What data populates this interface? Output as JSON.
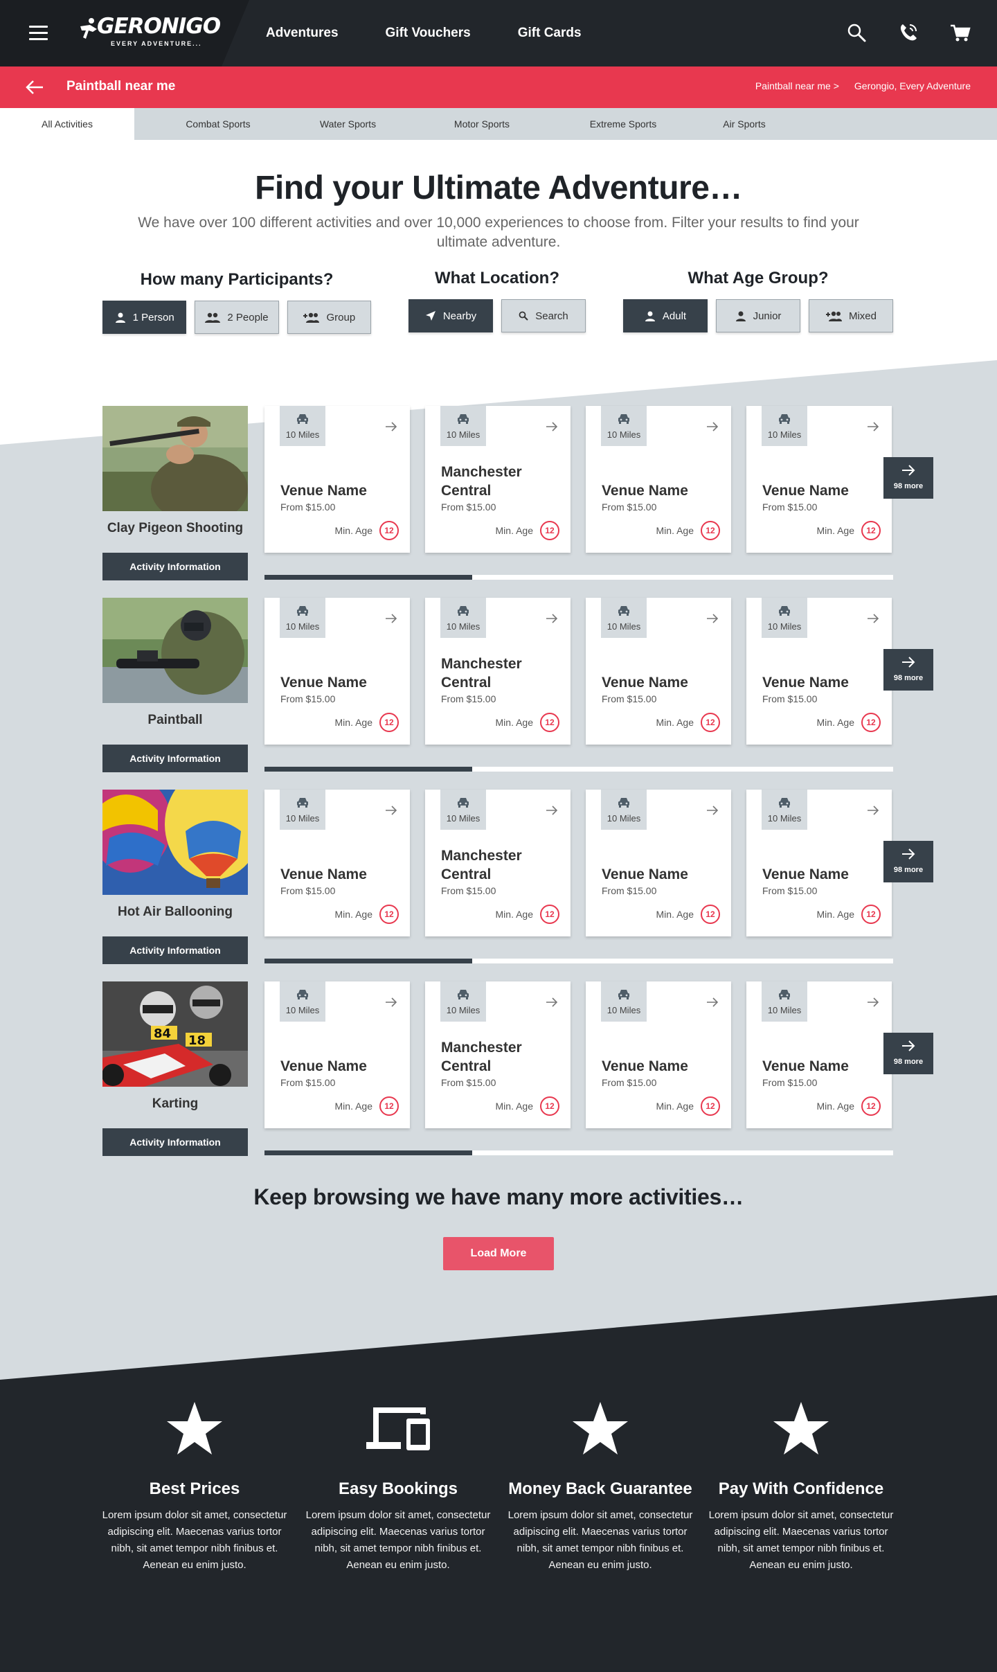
{
  "header": {
    "logo_text": "GERONIGO",
    "logo_tagline": "EVERY ADVENTURE...",
    "nav": [
      "Adventures",
      "Gift Vouchers",
      "Gift Cards"
    ],
    "icons": [
      "menu-icon",
      "search-icon",
      "phone-icon",
      "cart-icon"
    ]
  },
  "page_bar": {
    "title": "Paintball near me",
    "breadcrumbs": [
      "Paintball near me >",
      "Gerongio, Every Adventure"
    ]
  },
  "tabs": [
    {
      "label": "All Activities",
      "active": true
    },
    {
      "label": "Combat Sports",
      "active": false
    },
    {
      "label": "Water Sports",
      "active": false
    },
    {
      "label": "Motor Sports",
      "active": false
    },
    {
      "label": "Extreme Sports",
      "active": false
    },
    {
      "label": "Air Sports",
      "active": false
    }
  ],
  "hero": {
    "title": "Find your Ultimate Adventure…",
    "subtitle": "We have over 100 different activities and over 10,000 experiences to choose from. Filter your results to find your ultimate adventure."
  },
  "filters": {
    "participants": {
      "title": "How many Participants?",
      "options": [
        "1 Person",
        "2 People",
        "Group"
      ],
      "selected": "1 Person"
    },
    "location": {
      "title": "What Location?",
      "options": [
        "Nearby",
        "Search"
      ],
      "selected": "Nearby"
    },
    "age": {
      "title": "What Age Group?",
      "options": [
        "Adult",
        "Junior",
        "Mixed"
      ],
      "selected": "Adult"
    }
  },
  "activities": [
    {
      "name": "Clay Pigeon Shooting",
      "info_label": "Activity Information",
      "more_label": "98 more",
      "progress": 0.33,
      "venues": [
        {
          "distance": "10 Miles",
          "name": "Venue Name",
          "price": "From $15.00",
          "min_age_label": "Min. Age",
          "min_age": "12"
        },
        {
          "distance": "10 Miles",
          "name": "Manchester Central",
          "price": "From $15.00",
          "min_age_label": "Min. Age",
          "min_age": "12"
        },
        {
          "distance": "10 Miles",
          "name": "Venue Name",
          "price": "From $15.00",
          "min_age_label": "Min. Age",
          "min_age": "12"
        },
        {
          "distance": "10 Miles",
          "name": "Venue Name",
          "price": "From $15.00",
          "min_age_label": "Min. Age",
          "min_age": "12"
        }
      ]
    },
    {
      "name": "Paintball",
      "info_label": "Activity Information",
      "more_label": "98 more",
      "progress": 0.33,
      "venues": [
        {
          "distance": "10 Miles",
          "name": "Venue Name",
          "price": "From $15.00",
          "min_age_label": "Min. Age",
          "min_age": "12"
        },
        {
          "distance": "10 Miles",
          "name": "Manchester Central",
          "price": "From $15.00",
          "min_age_label": "Min. Age",
          "min_age": "12"
        },
        {
          "distance": "10 Miles",
          "name": "Venue Name",
          "price": "From $15.00",
          "min_age_label": "Min. Age",
          "min_age": "12"
        },
        {
          "distance": "10 Miles",
          "name": "Venue Name",
          "price": "From $15.00",
          "min_age_label": "Min. Age",
          "min_age": "12"
        }
      ]
    },
    {
      "name": "Hot Air Ballooning",
      "info_label": "Activity Information",
      "more_label": "98 more",
      "progress": 0.33,
      "venues": [
        {
          "distance": "10 Miles",
          "name": "Venue Name",
          "price": "From $15.00",
          "min_age_label": "Min. Age",
          "min_age": "12"
        },
        {
          "distance": "10 Miles",
          "name": "Manchester Central",
          "price": "From $15.00",
          "min_age_label": "Min. Age",
          "min_age": "12"
        },
        {
          "distance": "10 Miles",
          "name": "Venue Name",
          "price": "From $15.00",
          "min_age_label": "Min. Age",
          "min_age": "12"
        },
        {
          "distance": "10 Miles",
          "name": "Venue Name",
          "price": "From $15.00",
          "min_age_label": "Min. Age",
          "min_age": "12"
        }
      ]
    },
    {
      "name": "Karting",
      "info_label": "Activity Information",
      "more_label": "98 more",
      "progress": 0.33,
      "venues": [
        {
          "distance": "10 Miles",
          "name": "Venue Name",
          "price": "From $15.00",
          "min_age_label": "Min. Age",
          "min_age": "12"
        },
        {
          "distance": "10 Miles",
          "name": "Manchester Central",
          "price": "From $15.00",
          "min_age_label": "Min. Age",
          "min_age": "12"
        },
        {
          "distance": "10 Miles",
          "name": "Venue Name",
          "price": "From $15.00",
          "min_age_label": "Min. Age",
          "min_age": "12"
        },
        {
          "distance": "10 Miles",
          "name": "Venue Name",
          "price": "From $15.00",
          "min_age_label": "Min. Age",
          "min_age": "12"
        }
      ]
    }
  ],
  "browse": {
    "heading": "Keep browsing we have many more activities…",
    "load_more": "Load More"
  },
  "features": [
    {
      "icon": "star-icon",
      "title": "Best Prices",
      "text": "Lorem ipsum dolor sit amet, consectetur adipiscing elit. Maecenas varius tortor nibh, sit amet tempor nibh finibus et. Aenean eu enim justo."
    },
    {
      "icon": "devices-icon",
      "title": "Easy Bookings",
      "text": "Lorem ipsum dolor sit amet, consectetur adipiscing elit. Maecenas varius tortor nibh, sit amet tempor nibh finibus et. Aenean eu enim justo."
    },
    {
      "icon": "star-icon",
      "title": "Money Back Guarantee",
      "text": "Lorem ipsum dolor sit amet, consectetur adipiscing elit. Maecenas varius tortor nibh, sit amet tempor nibh finibus et. Aenean eu enim justo."
    },
    {
      "icon": "star-icon",
      "title": "Pay With Confidence",
      "text": "Lorem ipsum dolor sit amet, consectetur adipiscing elit. Maecenas varius tortor nibh, sit amet tempor nibh finibus et. Aenean eu enim justo."
    }
  ],
  "colors": {
    "dark": "#22262b",
    "accent_red": "#e8384f",
    "slate": "#37414a",
    "band_grey": "#d5dbdf"
  }
}
